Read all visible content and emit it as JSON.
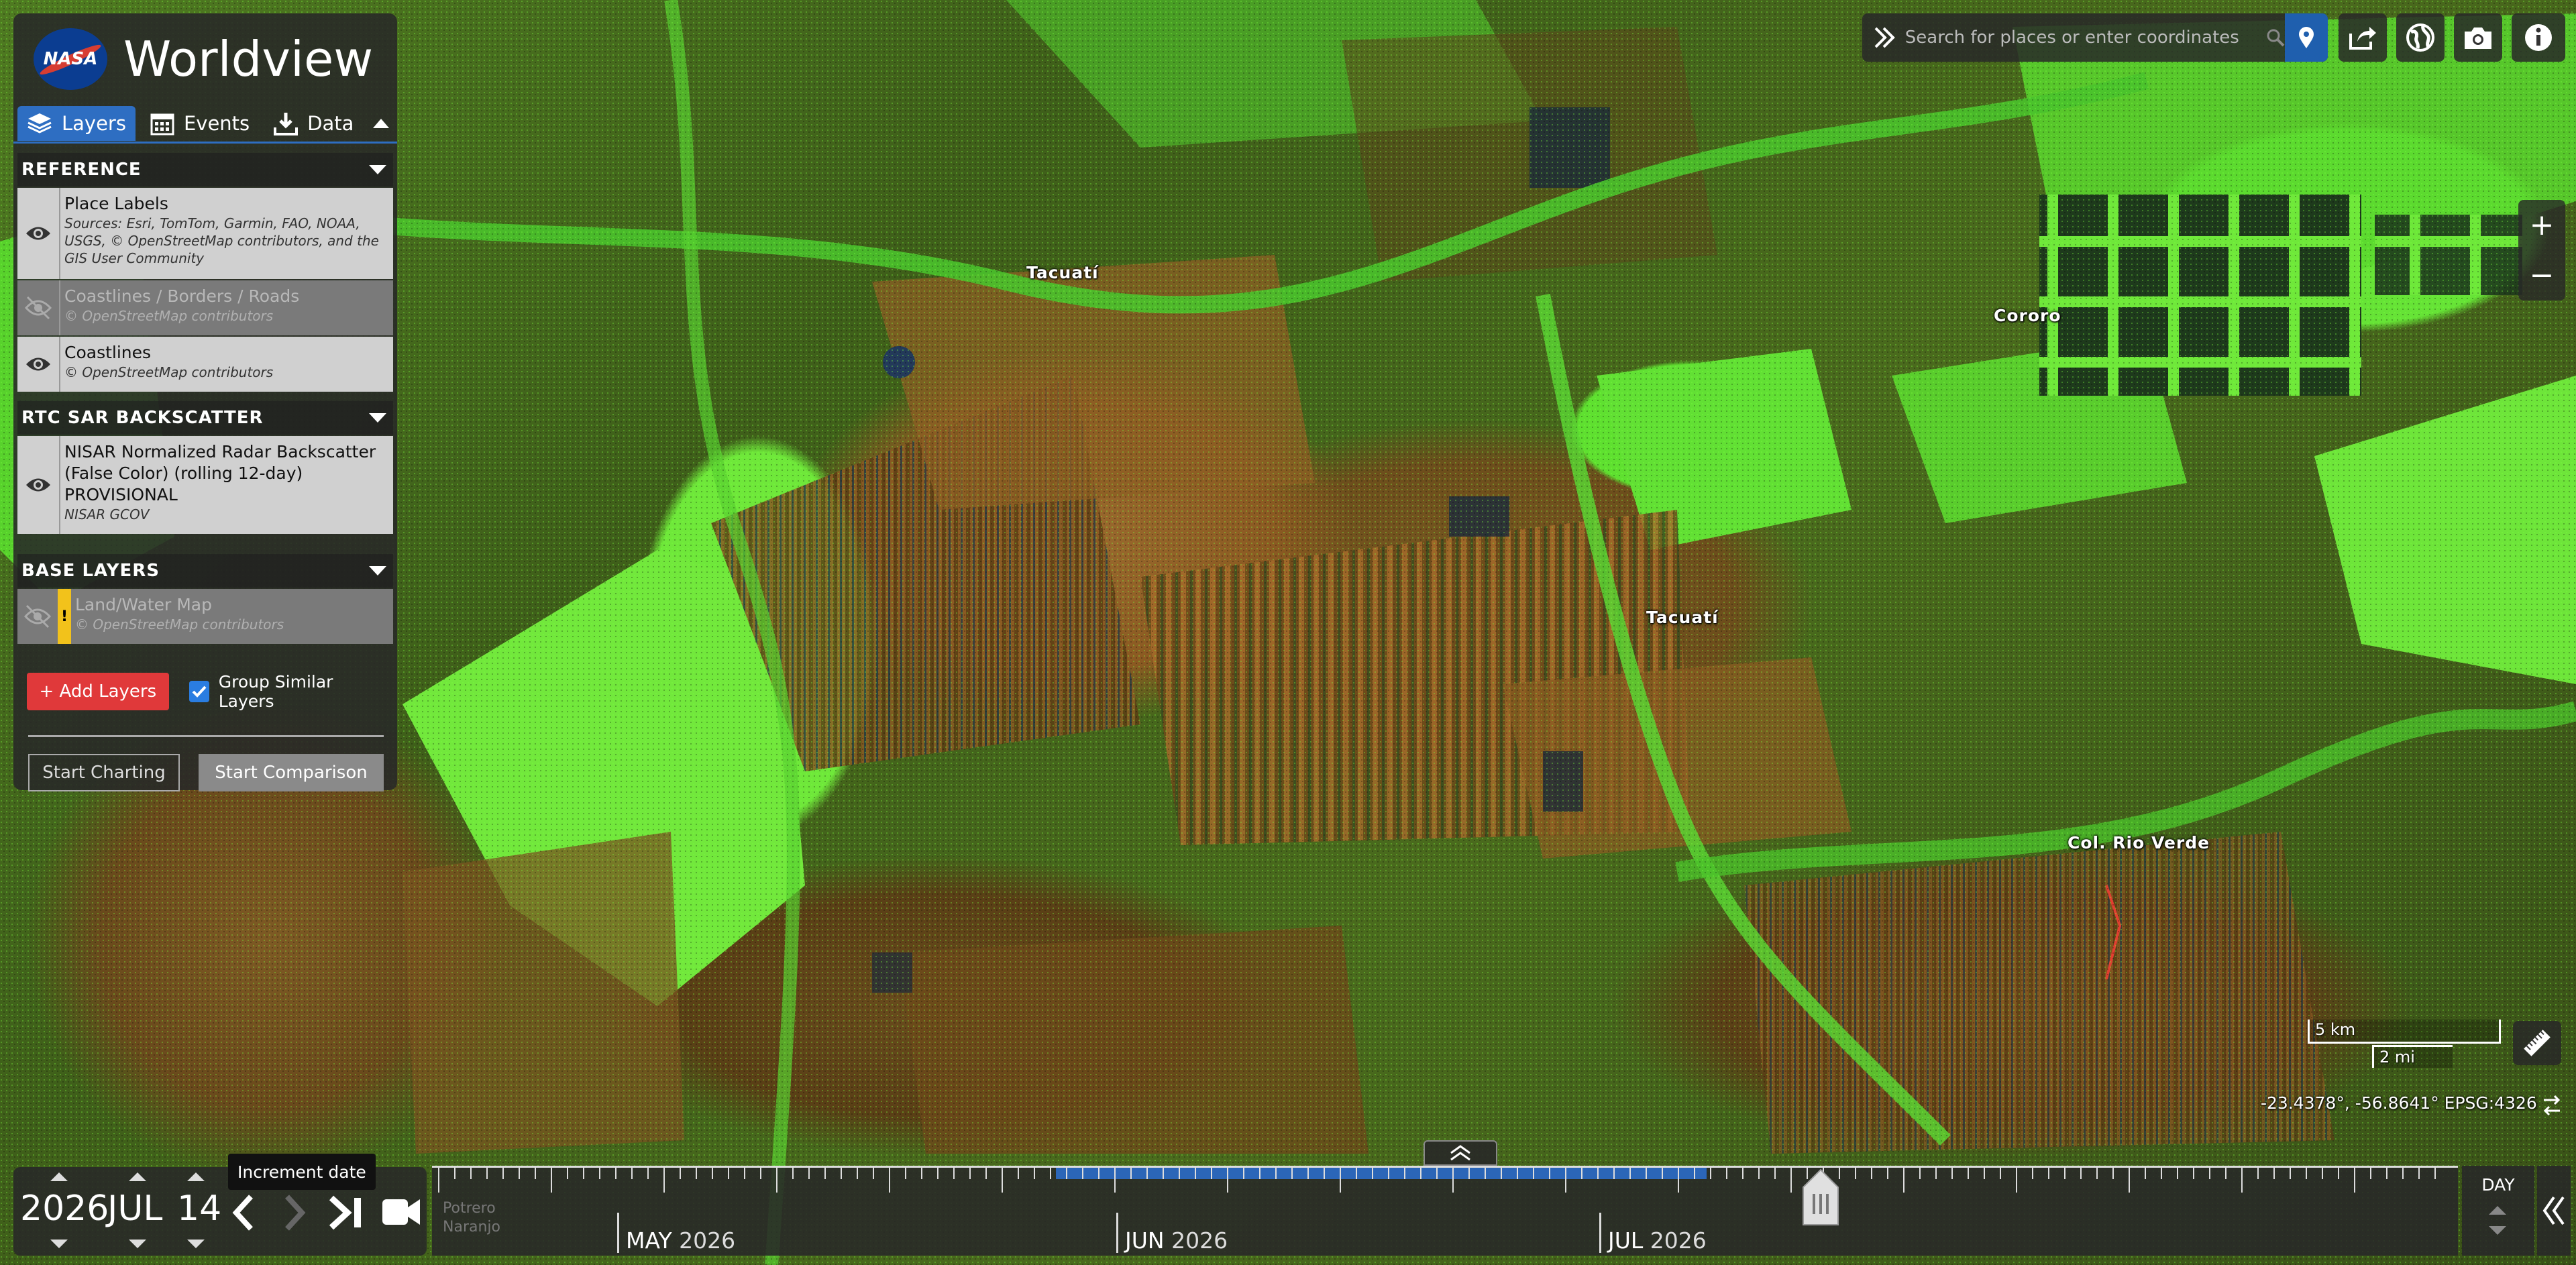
{
  "app": {
    "title": "Worldview",
    "logo_text": "NASA"
  },
  "tabs": [
    {
      "label": "Layers",
      "icon": "layers-icon",
      "active": true
    },
    {
      "label": "Events",
      "icon": "calendar-icon"
    },
    {
      "label": "Data",
      "icon": "download-icon"
    }
  ],
  "categories": {
    "reference": {
      "title": "REFERENCE"
    },
    "sar": {
      "title": "RTC SAR BACKSCATTER"
    },
    "base": {
      "title": "BASE LAYERS"
    }
  },
  "layers": {
    "place_labels": {
      "name": "Place Labels",
      "source": "Sources: Esri, TomTom, Garmin, FAO, NOAA, USGS, © OpenStreetMap contributors, and the GIS User Community",
      "visible": true
    },
    "coast_borders_roads": {
      "name": "Coastlines / Borders / Roads",
      "source": "© OpenStreetMap contributors",
      "visible": false
    },
    "coastlines": {
      "name": "Coastlines",
      "source": "© OpenStreetMap contributors",
      "visible": true
    },
    "nisar": {
      "name": "NISAR Normalized Radar Backscatter (False Color) (rolling 12-day) PROVISIONAL",
      "source": "NISAR GCOV",
      "visible": true
    },
    "landwater": {
      "name": "Land/Water Map",
      "source": "© OpenStreetMap contributors",
      "visible": false,
      "warning": "!"
    }
  },
  "actions": {
    "add_layers": "+ Add Layers",
    "group_similar": "Group Similar Layers",
    "group_checked": true,
    "start_charting": "Start Charting",
    "start_comparison": "Start Comparison"
  },
  "search": {
    "placeholder": "Search for places or enter coordinates"
  },
  "map_labels": {
    "tacuati_1": "Tacuatí",
    "tacuati_2": "Tacuatí",
    "cororo": "Cororo",
    "col_rio_verde": "Col. Rio Verde"
  },
  "zoom": {
    "in": "+",
    "out": "−"
  },
  "scale": {
    "km": "5 km",
    "mi": "2 mi"
  },
  "coordinates": "-23.4378°, -56.8641° EPSG:4326",
  "date": {
    "year": "2026",
    "month": "JUL",
    "day": "14"
  },
  "tooltip": "Increment date",
  "timeline": {
    "months": [
      {
        "month": "MAY",
        "year": "2026"
      },
      {
        "month": "JUN",
        "year": "2026"
      },
      {
        "month": "JUL",
        "year": "2026"
      }
    ],
    "zoom_level": "DAY",
    "ghost_label": "Potrero\nNaranjo"
  },
  "colors": {
    "accent": "#2e6ec2",
    "add_button": "#e0393a",
    "checkbox": "#2a7de1",
    "vegetation": "#6fe83a",
    "coverage": "#2b66b8"
  }
}
